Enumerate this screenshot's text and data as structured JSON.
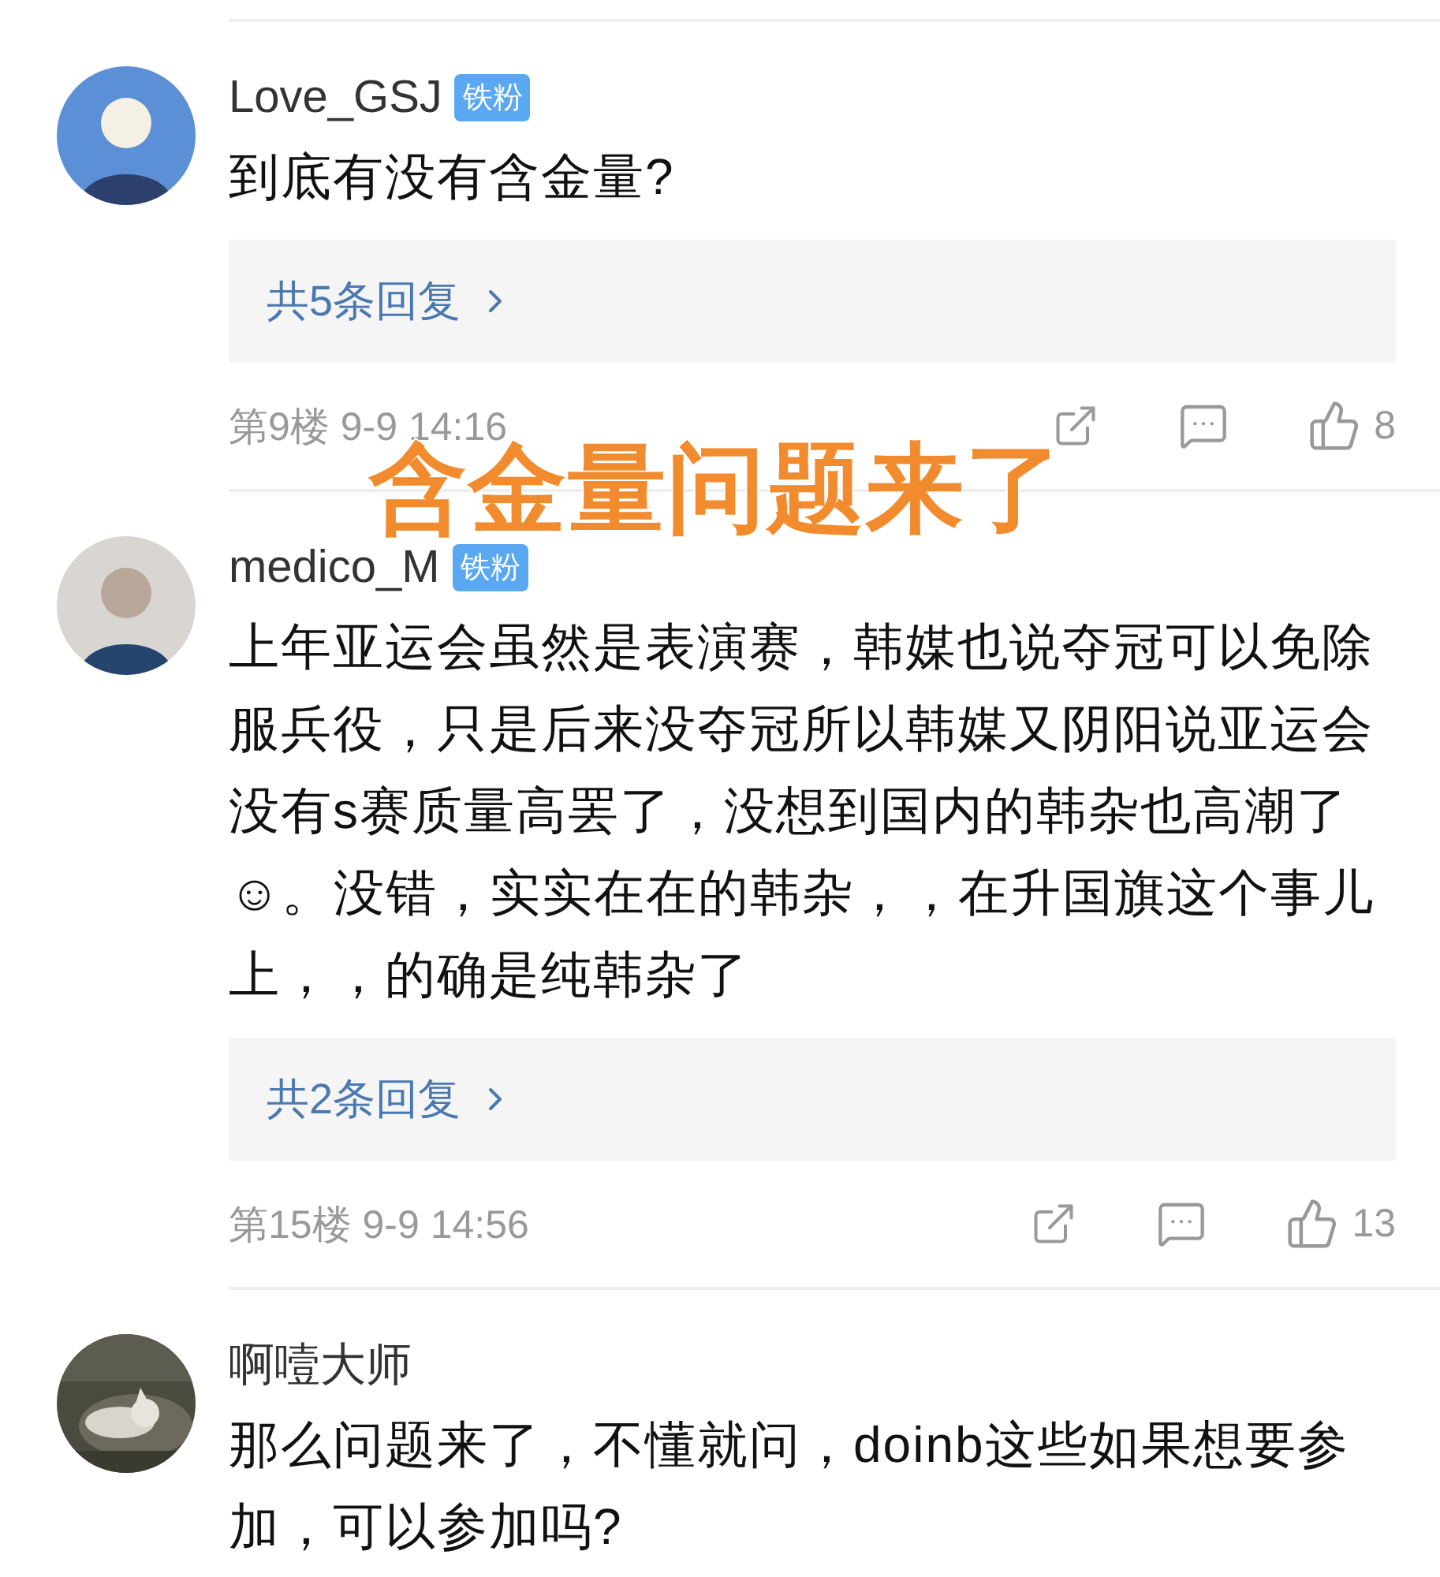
{
  "comments": [
    {
      "user": "Love_GSJ",
      "badge": "铁粉",
      "avatar": {
        "kind": "silhouette"
      },
      "body": "到底有没有含金量?",
      "replies": "共5条回复",
      "floor": "第9楼",
      "time": "9-9 14:16",
      "likes": "8"
    },
    {
      "user": "medico_M",
      "badge": "铁粉",
      "avatar": {
        "kind": "silhouette"
      },
      "body": "上年亚运会虽然是表演赛，韩媒也说夺冠可以免除服兵役，只是后来没夺冠所以韩媒又阴阳说亚运会没有s赛质量高罢了，没想到国内的韩杂也高潮了☺。没错，实实在在的韩杂，，在升国旗这个事儿上，，的确是纯韩杂了",
      "replies": "共2条回复",
      "floor": "第15楼",
      "time": "9-9 14:56",
      "likes": "13"
    },
    {
      "user": "啊噎大师",
      "body": "那么问题来了，不懂就问，doinb这些如果想要参加，可以参加吗?"
    }
  ],
  "caption": "含金量问题来了"
}
